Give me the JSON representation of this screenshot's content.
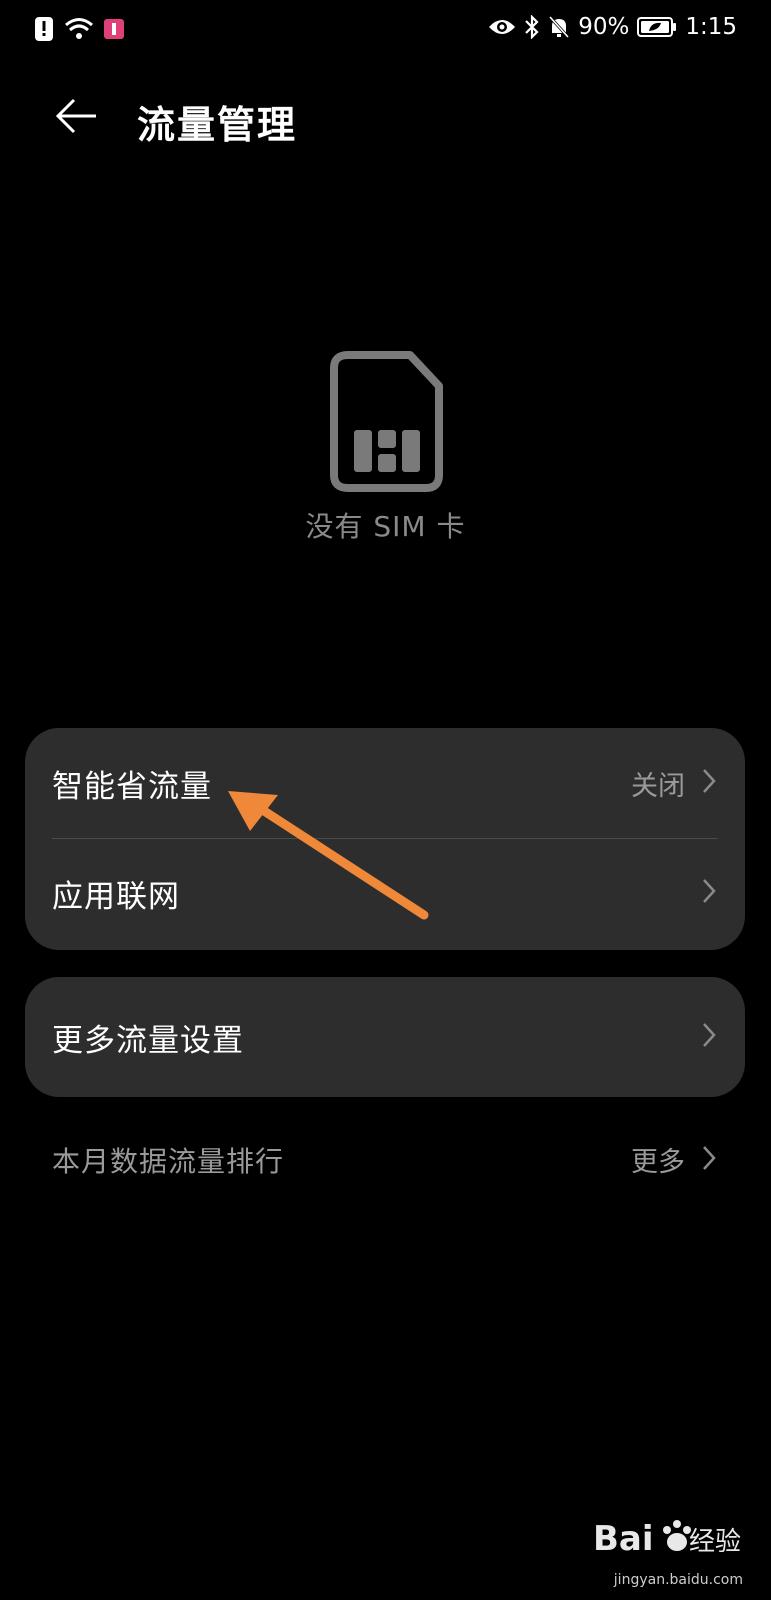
{
  "status_bar": {
    "battery_percent": "90%",
    "time": "1:15",
    "icons": [
      "alert-icon",
      "wifi-icon",
      "app-notification-icon",
      "eye-icon",
      "bluetooth-icon",
      "mute-bell-icon",
      "battery-icon"
    ]
  },
  "header": {
    "title": "流量管理",
    "back_icon": "back-arrow-icon"
  },
  "sim": {
    "icon": "sim-card-icon",
    "label": "没有 SIM 卡"
  },
  "settings_group_1": {
    "items": [
      {
        "label": "智能省流量",
        "value": "关闭"
      },
      {
        "label": "应用联网",
        "value": ""
      }
    ]
  },
  "settings_group_2": {
    "items": [
      {
        "label": "更多流量设置",
        "value": ""
      }
    ]
  },
  "ranking": {
    "label": "本月数据流量排行",
    "more": "更多"
  },
  "annotation": {
    "type": "arrow",
    "color": "#f0883a",
    "points_to": "智能省流量"
  },
  "watermark": {
    "text": "jingyan.baidu.com"
  }
}
